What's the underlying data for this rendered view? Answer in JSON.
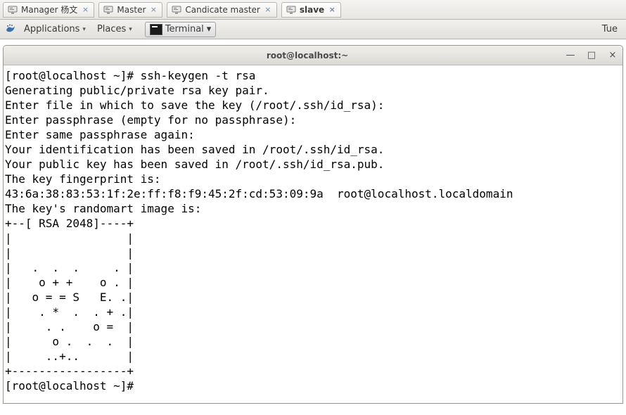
{
  "outer_tabs": {
    "items": [
      {
        "label": "Manager 杨文"
      },
      {
        "label": "Master"
      },
      {
        "label": "Candicate master"
      },
      {
        "label": "slave"
      }
    ],
    "active_index": 3
  },
  "desktop_bar": {
    "applications": "Applications",
    "places": "Places",
    "app_name": "Terminal",
    "clock": "Tue"
  },
  "terminal_window": {
    "title": "root@localhost:~",
    "minimize": "—",
    "maximize": "□",
    "close": "×"
  },
  "terminal_lines": [
    "[root@localhost ~]# ssh-keygen -t rsa",
    "Generating public/private rsa key pair.",
    "Enter file in which to save the key (/root/.ssh/id_rsa):",
    "Enter passphrase (empty for no passphrase):",
    "Enter same passphrase again:",
    "Your identification has been saved in /root/.ssh/id_rsa.",
    "Your public key has been saved in /root/.ssh/id_rsa.pub.",
    "The key fingerprint is:",
    "43:6a:38:83:53:1f:2e:ff:f8:f9:45:2f:cd:53:09:9a  root@localhost.localdomain",
    "The key's randomart image is:",
    "+--[ RSA 2048]----+",
    "|                 |",
    "|                 |",
    "|   .  .  .     . |",
    "|    o + +    o . |",
    "|   o = = S   E. .|",
    "|    . *  .  . + .|",
    "|     . .    o =  |",
    "|      o .  .  .  |",
    "|     ..+..       |",
    "+-----------------+",
    "[root@localhost ~]#"
  ]
}
